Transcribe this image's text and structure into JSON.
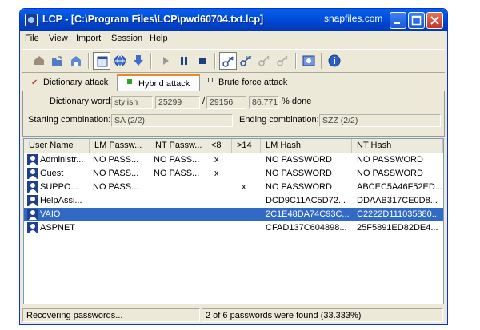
{
  "window": {
    "title": "LCP - [C:\\Program Files\\LCP\\pwd60704.txt.lcp]",
    "watermark": "snapfiles.com"
  },
  "menu": [
    "File",
    "View",
    "Import",
    "Session",
    "Help"
  ],
  "toolbar": {
    "icons": [
      "import-icon",
      "open-icon",
      "save-icon",
      "select-all-icon",
      "globe-icon",
      "download-icon",
      "play-icon",
      "pause-icon",
      "stop-icon",
      "lm-key-icon",
      "nt-key-icon",
      "lm-key-disabled-icon",
      "nt-key-disabled-icon",
      "options-icon",
      "help-icon"
    ]
  },
  "tabs": [
    {
      "label": "Dictionary attack",
      "checked": true
    },
    {
      "label": "Hybrid attack",
      "checked": true
    },
    {
      "label": "Brute force attack",
      "checked": false
    }
  ],
  "attack": {
    "dictionary_word_label": "Dictionary word:",
    "dictionary_word": "stylish",
    "current": "25299",
    "sep": "/",
    "total": "29156",
    "percent": "86.771",
    "percent_suffix": "% done",
    "starting_label": "Starting combination:",
    "starting_value": "SA (2/2)",
    "ending_label": "Ending combination:",
    "ending_value": "SZZ (2/2)"
  },
  "columns": [
    "User Name",
    "LM Passw...",
    "NT Passw...",
    "<8",
    ">14",
    "LM Hash",
    "NT Hash"
  ],
  "rows": [
    {
      "user": "Administr...",
      "lm_pass": "NO PASS...",
      "nt_pass": "NO PASS...",
      "lt8": "x",
      "gt14": "",
      "lm_hash": "NO PASSWORD",
      "nt_hash": "NO PASSWORD"
    },
    {
      "user": "Guest",
      "lm_pass": "NO PASS...",
      "nt_pass": "NO PASS...",
      "lt8": "x",
      "gt14": "",
      "lm_hash": "NO PASSWORD",
      "nt_hash": "NO PASSWORD"
    },
    {
      "user": "SUPPO...",
      "lm_pass": "NO PASS...",
      "nt_pass": "",
      "lt8": "",
      "gt14": "x",
      "lm_hash": "NO PASSWORD",
      "nt_hash": "ABCEC5A46F52ED..."
    },
    {
      "user": "HelpAssi...",
      "lm_pass": "",
      "nt_pass": "",
      "lt8": "",
      "gt14": "",
      "lm_hash": "DCD9C11AC5D72...",
      "nt_hash": "DDAAB317CE0D8..."
    },
    {
      "user": "VAIO",
      "lm_pass": "",
      "nt_pass": "",
      "lt8": "",
      "gt14": "",
      "lm_hash": "2C1E48DA74C93C...",
      "nt_hash": "C2222D111035880..."
    },
    {
      "user": "ASPNET",
      "lm_pass": "",
      "nt_pass": "",
      "lt8": "",
      "gt14": "",
      "lm_hash": "CFAD137C604898...",
      "nt_hash": "25F5891ED82DE4..."
    }
  ],
  "selected_row": 4,
  "status": {
    "left": "Recovering passwords...",
    "right": "2 of 6 passwords were found (33.333%)"
  },
  "colors": {
    "titlebar": "#0054e3",
    "selection": "#316ac5",
    "chrome": "#ece9d8"
  }
}
